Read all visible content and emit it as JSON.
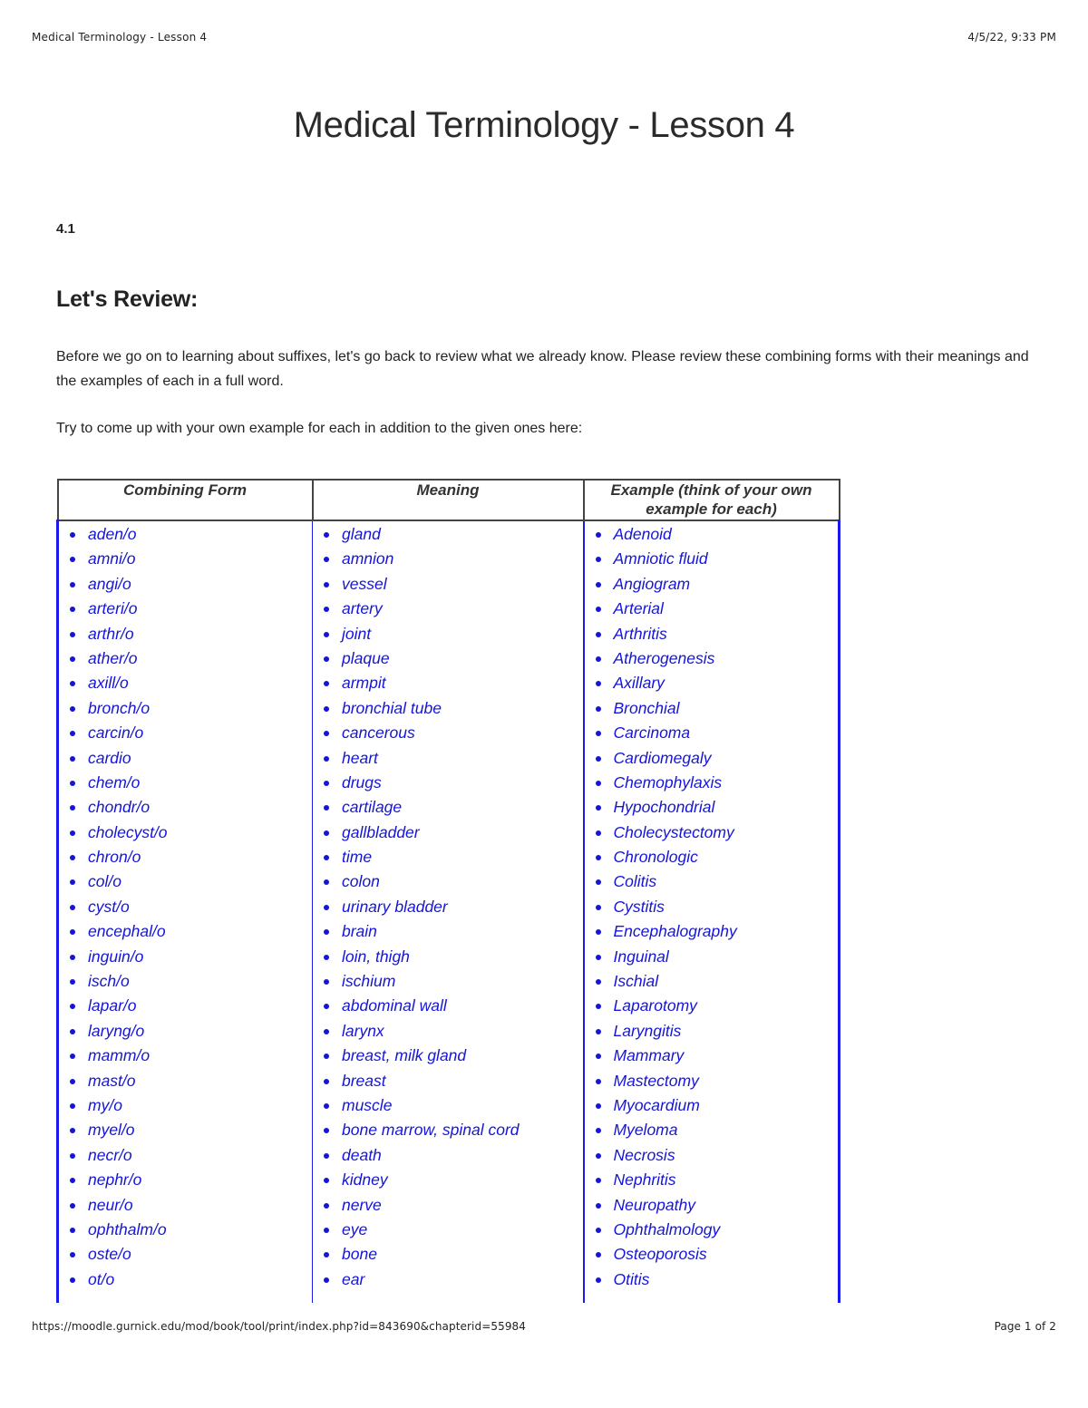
{
  "print_header": {
    "title": "Medical Terminology - Lesson 4",
    "datetime": "4/5/22, 9:33 PM"
  },
  "print_footer": {
    "url": "https://moodle.gurnick.edu/mod/book/tool/print/index.php?id=843690&chapterid=55984",
    "page": "Page 1 of 2"
  },
  "page_title": "Medical Terminology - Lesson 4",
  "section": {
    "number": "4.1",
    "heading": "Let's Review:",
    "intro": "Before we go on to learning about suffixes, let's go back to review what we already know. Please review these combining forms with their meanings and the examples of each in a full word.",
    "prompt": "Try to come up with your own example for each in addition to the given ones here:"
  },
  "table": {
    "headers": [
      "Combining Form",
      "Meaning",
      "Example (think of your own example for each)"
    ],
    "rows": [
      {
        "form": "aden/o",
        "meaning": "gland",
        "example": "Adenoid"
      },
      {
        "form": "amni/o",
        "meaning": "amnion",
        "example": "Amniotic fluid"
      },
      {
        "form": "angi/o",
        "meaning": "vessel",
        "example": "Angiogram"
      },
      {
        "form": "arteri/o",
        "meaning": "artery",
        "example": "Arterial"
      },
      {
        "form": "arthr/o",
        "meaning": "joint",
        "example": "Arthritis"
      },
      {
        "form": "ather/o",
        "meaning": "plaque",
        "example": "Atherogenesis"
      },
      {
        "form": "axill/o",
        "meaning": "armpit",
        "example": "Axillary"
      },
      {
        "form": "bronch/o",
        "meaning": "bronchial tube",
        "example": "Bronchial"
      },
      {
        "form": "carcin/o",
        "meaning": "cancerous",
        "example": "Carcinoma"
      },
      {
        "form": "cardio",
        "meaning": "heart",
        "example": "Cardiomegaly"
      },
      {
        "form": "chem/o",
        "meaning": "drugs",
        "example": "Chemophylaxis"
      },
      {
        "form": "chondr/o",
        "meaning": "cartilage",
        "example": "Hypochondrial"
      },
      {
        "form": "cholecyst/o",
        "meaning": "gallbladder",
        "example": "Cholecystectomy"
      },
      {
        "form": "chron/o",
        "meaning": "time",
        "example": "Chronologic"
      },
      {
        "form": "col/o",
        "meaning": "colon",
        "example": "Colitis"
      },
      {
        "form": "cyst/o",
        "meaning": "urinary bladder",
        "example": "Cystitis"
      },
      {
        "form": "encephal/o",
        "meaning": "brain",
        "example": "Encephalography"
      },
      {
        "form": "inguin/o",
        "meaning": "loin, thigh",
        "example": "Inguinal"
      },
      {
        "form": "isch/o",
        "meaning": "ischium",
        "example": "Ischial"
      },
      {
        "form": "lapar/o",
        "meaning": "abdominal wall",
        "example": "Laparotomy"
      },
      {
        "form": "laryng/o",
        "meaning": "larynx",
        "example": "Laryngitis"
      },
      {
        "form": "mamm/o",
        "meaning": "breast, milk gland",
        "example": "Mammary"
      },
      {
        "form": "mast/o",
        "meaning": "breast",
        "example": "Mastectomy"
      },
      {
        "form": "my/o",
        "meaning": "muscle",
        "example": "Myocardium"
      },
      {
        "form": "myel/o",
        "meaning": "bone marrow, spinal cord",
        "example": "Myeloma"
      },
      {
        "form": "necr/o",
        "meaning": "death",
        "example": "Necrosis"
      },
      {
        "form": "nephr/o",
        "meaning": "kidney",
        "example": "Nephritis"
      },
      {
        "form": "neur/o",
        "meaning": "nerve",
        "example": "Neuropathy"
      },
      {
        "form": "ophthalm/o",
        "meaning": "eye",
        "example": "Ophthalmology"
      },
      {
        "form": "oste/o",
        "meaning": "bone",
        "example": "Osteoporosis"
      },
      {
        "form": "ot/o",
        "meaning": "ear",
        "example": "Otitis"
      }
    ]
  }
}
